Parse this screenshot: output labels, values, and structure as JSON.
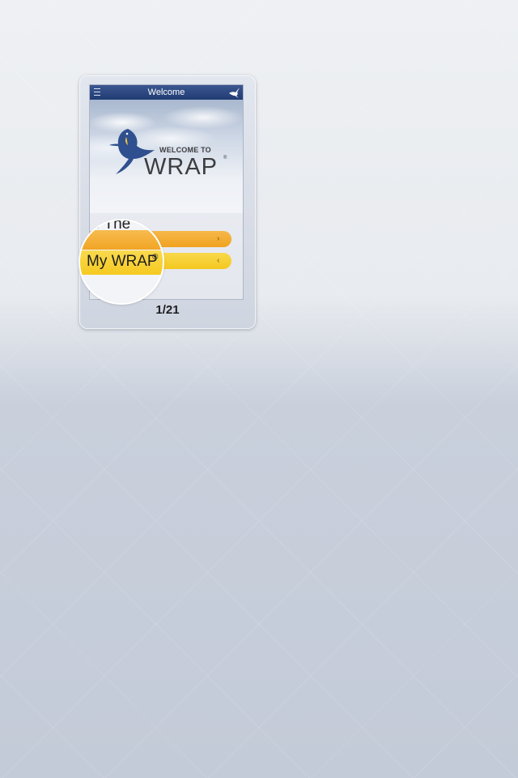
{
  "preview": {
    "navbar_title": "Welcome",
    "logo_welcome_to": "WELCOME TO",
    "logo_wrap": "WRAP",
    "logo_registered": "®",
    "buttons": [
      {
        "arrow": "›",
        "color": "#f0a21f"
      },
      {
        "arrow": "‹",
        "color": "#f4c820"
      }
    ]
  },
  "magnifier": {
    "partial_label": "e The",
    "label": "My WRAP",
    "registered": "®"
  },
  "page_counter": "1/21",
  "colors": {
    "navbar": "#203c73",
    "orange_button": "#f0a21f",
    "yellow_button": "#f4c820",
    "logo_bird": "#2f4f8f"
  }
}
